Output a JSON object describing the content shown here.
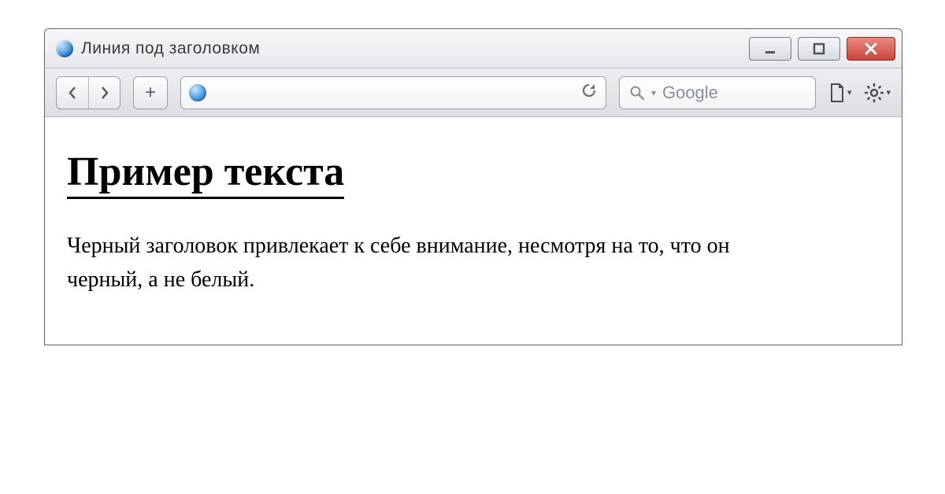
{
  "window": {
    "title": "Линия под заголовком"
  },
  "toolbar": {
    "search_placeholder": "Google"
  },
  "page": {
    "heading": "Пример текста",
    "paragraph": "Черный заголовок привлекает к себе внимание, несмотря на то, что он черный, а не белый."
  }
}
